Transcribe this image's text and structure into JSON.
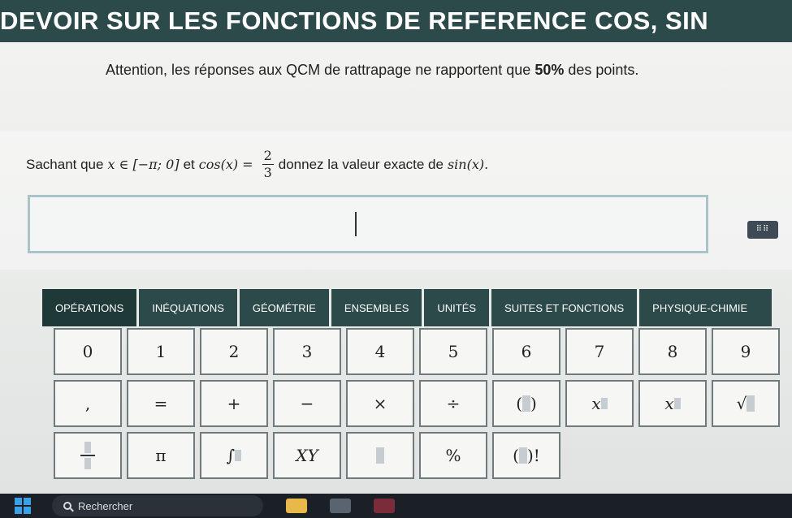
{
  "header": {
    "title": "DEVOIR SUR LES FONCTIONS DE REFERENCE COS, SIN"
  },
  "notice": {
    "text_before": "Attention, les réponses aux QCM de rattrapage ne rapportent que ",
    "text_bold": "50%",
    "text_after": " des points."
  },
  "question": {
    "part1": "Sachant que",
    "math1": "x ∈ [−π; 0]",
    "part2": "et",
    "math2": "cos(x) =",
    "frac_num": "2",
    "frac_den": "3",
    "part3": "donnez la valeur exacte de",
    "math3": "sin(x)."
  },
  "tabs": [
    {
      "label": "Opérations"
    },
    {
      "label": "Inéquations"
    },
    {
      "label": "Géométrie"
    },
    {
      "label": "Ensembles"
    },
    {
      "label": "Unités"
    },
    {
      "label": "Suites et fonctions"
    },
    {
      "label": "Physique-Chimie"
    }
  ],
  "keys": {
    "row1": [
      "0",
      "1",
      "2",
      "3",
      "4",
      "5",
      "6",
      "7",
      "8",
      "9"
    ],
    "row2": [
      ",",
      "=",
      "+",
      "−",
      "×",
      "÷"
    ],
    "pi": "π",
    "integral": "∫",
    "vector": "XY",
    "percent": "%",
    "factorial": "!"
  },
  "taskbar": {
    "search_placeholder": "Rechercher"
  },
  "colors": {
    "accent": "#2d4a4a",
    "answer_border": "#a9c3c8"
  }
}
